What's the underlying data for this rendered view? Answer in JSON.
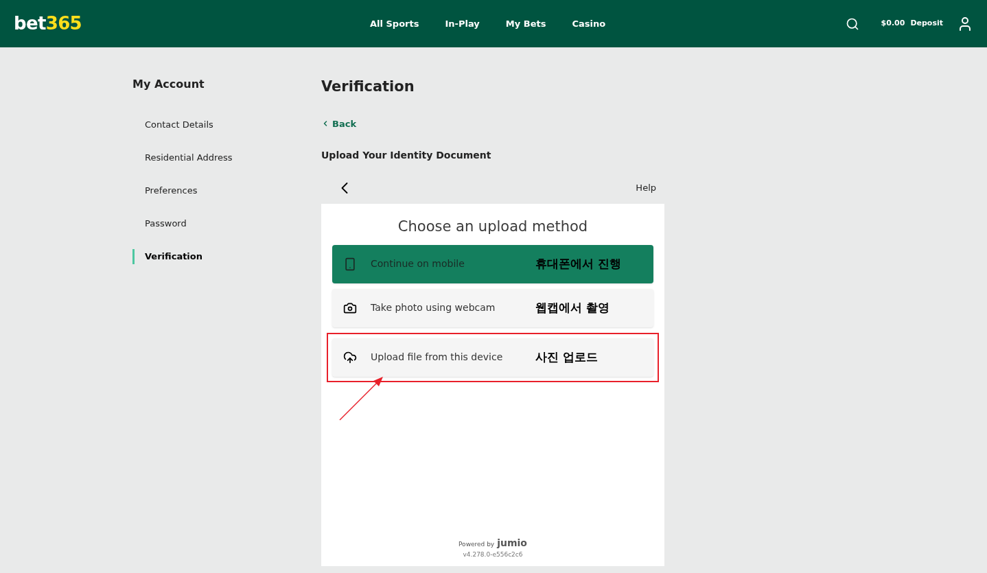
{
  "header": {
    "logo": {
      "part_1": "bet",
      "part_2": "365"
    },
    "nav": [
      {
        "label": "All Sports"
      },
      {
        "label": "In-Play"
      },
      {
        "label": "My Bets"
      },
      {
        "label": "Casino"
      }
    ],
    "balance": "$0.00",
    "deposit": "Deposit"
  },
  "sidebar": {
    "title": "My Account",
    "items": [
      {
        "label": "Contact Details",
        "selected": false
      },
      {
        "label": "Residential Address",
        "selected": false
      },
      {
        "label": "Preferences",
        "selected": false
      },
      {
        "label": "Password",
        "selected": false
      },
      {
        "label": "Verification",
        "selected": true
      }
    ]
  },
  "main": {
    "title": "Verification",
    "back": "Back",
    "subtitle": "Upload Your Identity Document",
    "help": "Help",
    "panel_title": "Choose an upload method",
    "options": [
      {
        "kind": "mobile",
        "label": "Continue on mobile",
        "annotation": "휴대폰에서 진행",
        "selected": true,
        "marked": false
      },
      {
        "kind": "webcam",
        "label": "Take photo using webcam",
        "annotation": "웹캡에서 촬영",
        "selected": false,
        "marked": false
      },
      {
        "kind": "upload",
        "label": "Upload file from this device",
        "annotation": "사진 업로드",
        "selected": false,
        "marked": true
      }
    ],
    "powered_by": "Powered by",
    "brand": "jumio",
    "version": "v4.278.0-e556c2c6"
  }
}
